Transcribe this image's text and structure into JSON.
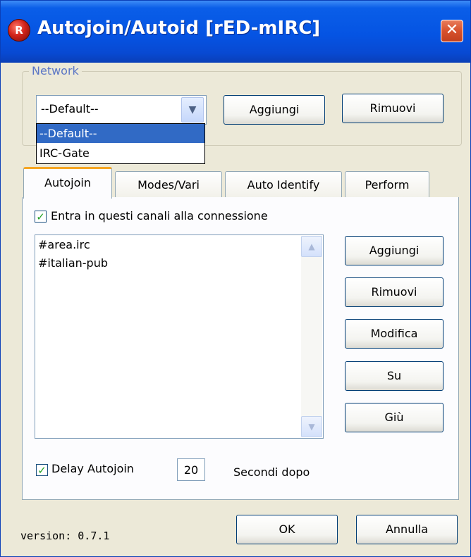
{
  "window": {
    "title": "Autojoin/Autoid [rED-mIRC]",
    "app_icon_text": "R",
    "close_glyph": "✕"
  },
  "network": {
    "legend": "Network",
    "combo_value": "--Default--",
    "combo_arrow_glyph": "▼",
    "options": [
      "--Default--",
      "IRC-Gate"
    ],
    "add_label": "Aggiungi",
    "remove_label": "Rimuovi"
  },
  "tabs": [
    {
      "label": "Autojoin",
      "active": true
    },
    {
      "label": "Modes/Vari",
      "active": false
    },
    {
      "label": "Auto Identify",
      "active": false
    },
    {
      "label": "Perform",
      "active": false
    }
  ],
  "autojoin": {
    "enable_label": "Entra in questi canali alla connessione",
    "enable_checked": true,
    "check_glyph": "✓",
    "channels": [
      "#area.irc",
      "#italian-pub"
    ],
    "scroll_up_glyph": "▲",
    "scroll_down_glyph": "▼",
    "buttons": {
      "add": "Aggiungi",
      "remove": "Rimuovi",
      "edit": "Modifica",
      "up": "Su",
      "down": "Giù"
    },
    "delay_label": "Delay Autojoin",
    "delay_checked": true,
    "delay_value": "20",
    "delay_suffix": "Secondi dopo"
  },
  "footer": {
    "version": "version: 0.7.1",
    "ok_label": "OK",
    "cancel_label": "Annulla"
  },
  "colors": {
    "titlebar": "#0554e3",
    "dialog_bg": "#ece9d8",
    "selection": "#316ac5",
    "close_button": "#d7512c",
    "tab_highlight": "#f5a623",
    "checkmark": "#21a121"
  }
}
